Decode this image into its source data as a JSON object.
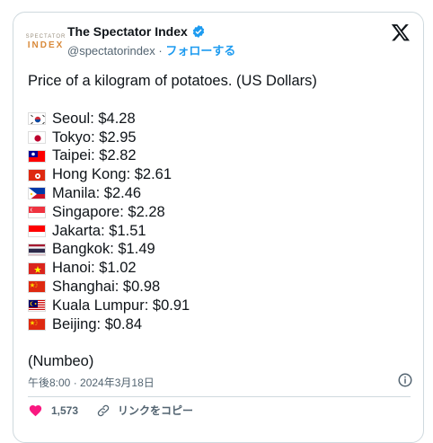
{
  "account": {
    "logo_top": "SPECTATOR",
    "logo_bottom": "INDEX",
    "name": "The Spectator Index",
    "handle": "@spectatorindex",
    "separator": "·",
    "follow_label": "フォローする"
  },
  "tweet": {
    "title": "Price of a kilogram of potatoes. (US Dollars)",
    "items": [
      {
        "flag": "kr",
        "text": "Seoul: $4.28"
      },
      {
        "flag": "jp",
        "text": "Tokyo: $2.95"
      },
      {
        "flag": "tw",
        "text": "Taipei: $2.82"
      },
      {
        "flag": "hk",
        "text": "Hong Kong: $2.61"
      },
      {
        "flag": "ph",
        "text": "Manila: $2.46"
      },
      {
        "flag": "sg",
        "text": "Singapore: $2.28"
      },
      {
        "flag": "id",
        "text": "Jakarta: $1.51"
      },
      {
        "flag": "th",
        "text": "Bangkok: $1.49"
      },
      {
        "flag": "vn",
        "text": "Hanoi: $1.02"
      },
      {
        "flag": "cn",
        "text": "Shanghai: $0.98"
      },
      {
        "flag": "my",
        "text": "Kuala Lumpur: $0.91"
      },
      {
        "flag": "cn",
        "text": "Beijing: $0.84"
      }
    ],
    "source": "(Numbeo)",
    "timestamp": "午後8:00 · 2024年3月18日"
  },
  "actions": {
    "like_count": "1,573",
    "copy_link_label": "リンクをコピー"
  },
  "colors": {
    "accent": "#1d9bf0",
    "like": "#f91880",
    "muted": "#536471",
    "border": "#cfd9de"
  },
  "icons": {
    "close": "x-logo-icon",
    "verified": "verified-badge-icon",
    "info": "info-icon",
    "like": "heart-icon",
    "link": "link-icon"
  }
}
